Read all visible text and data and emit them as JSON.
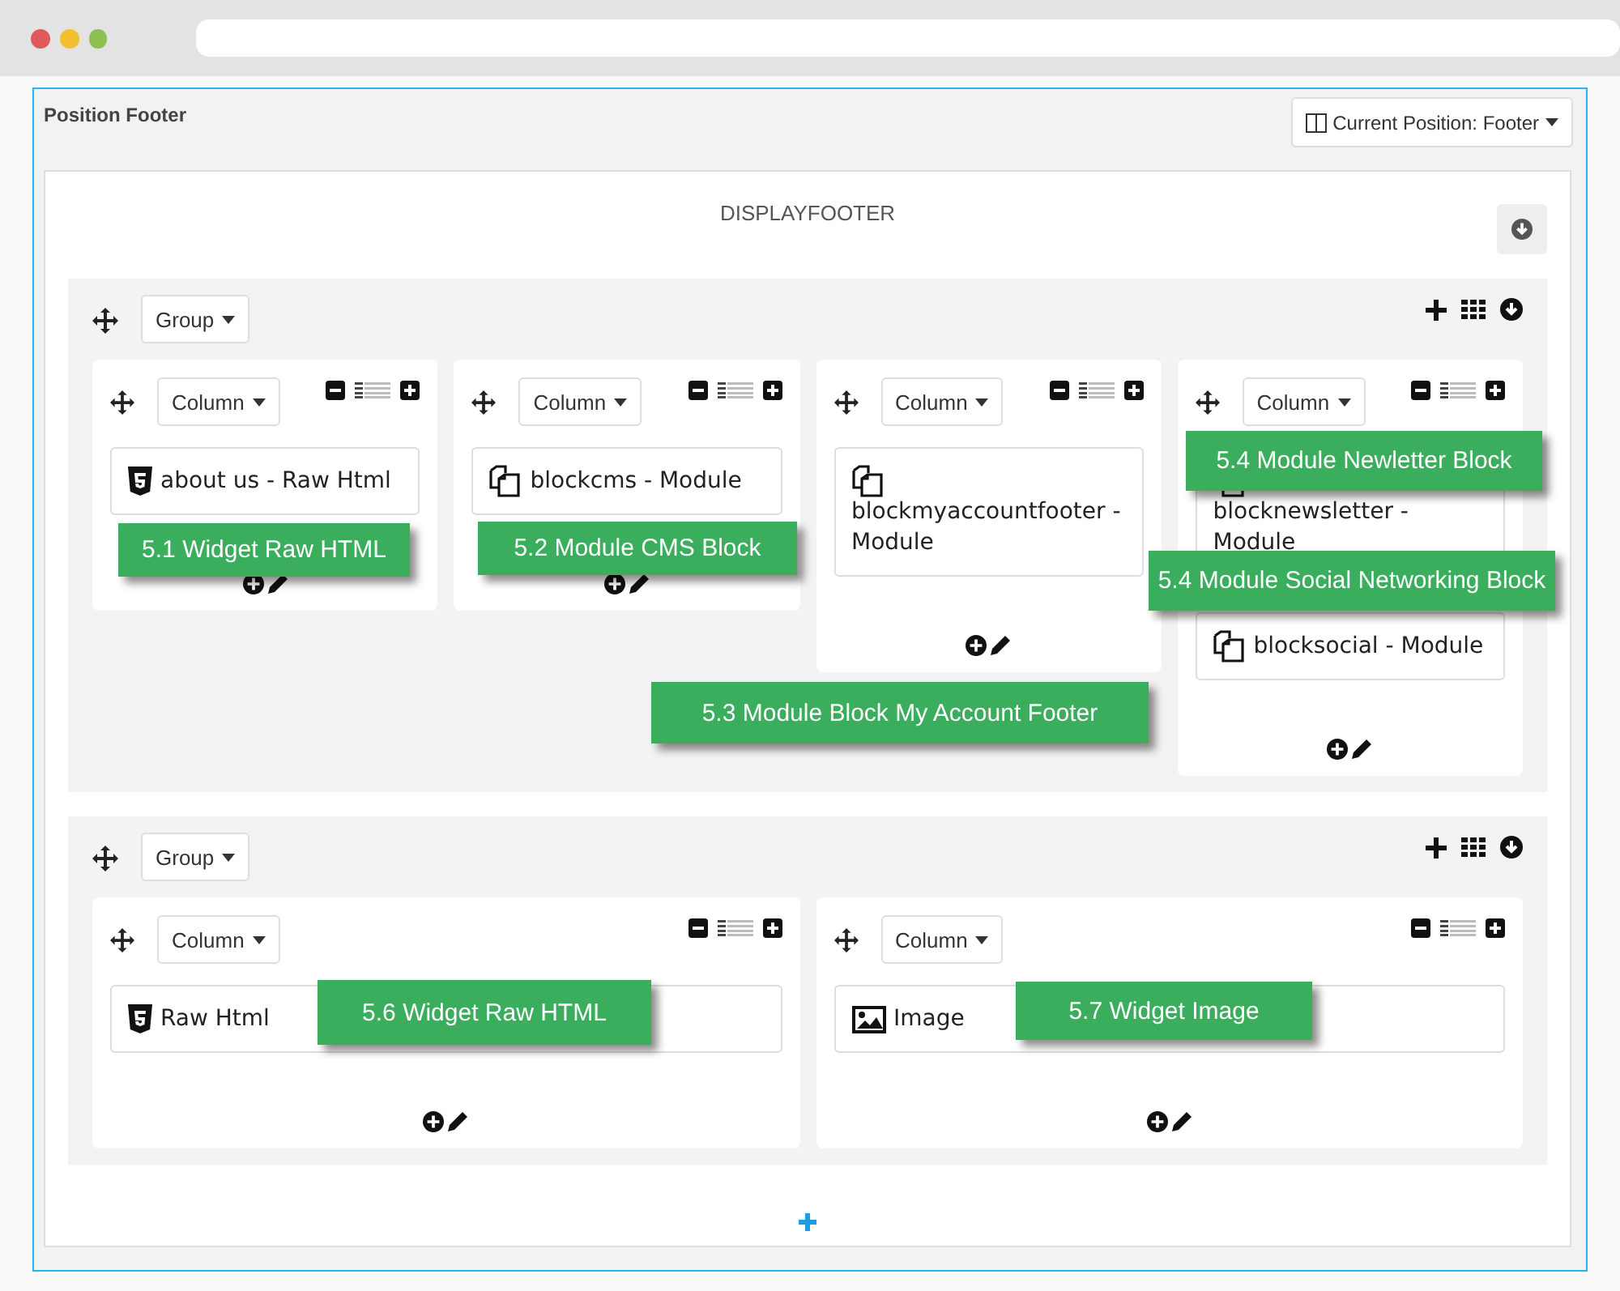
{
  "section_title": "Position Footer",
  "position_button": "Current Position: Footer",
  "hook_title": "DISPLAYFOOTER",
  "groups": [
    {
      "label": "Group",
      "columns": [
        {
          "label": "Column",
          "modules": [
            {
              "kind": "html",
              "text": "about us - Raw Html"
            }
          ]
        },
        {
          "label": "Column",
          "modules": [
            {
              "kind": "module",
              "text": "blockcms - Module"
            }
          ]
        },
        {
          "label": "Column",
          "modules": [
            {
              "kind": "module",
              "text": "blockmyaccountfooter - Module"
            }
          ]
        },
        {
          "label": "Column",
          "modules": [
            {
              "kind": "module",
              "text": "blocknewsletter - Module"
            },
            {
              "kind": "module",
              "text": "blocksocial - Module"
            }
          ]
        }
      ]
    },
    {
      "label": "Group",
      "columns": [
        {
          "label": "Column",
          "modules": [
            {
              "kind": "html",
              "text": "Raw Html"
            }
          ]
        },
        {
          "label": "Column",
          "modules": [
            {
              "kind": "image",
              "text": "Image"
            }
          ]
        }
      ]
    }
  ],
  "callouts": [
    {
      "text": "5.1 Widget Raw HTML"
    },
    {
      "text": "5.2 Module CMS Block"
    },
    {
      "text": "5.3 Module Block My Account Footer"
    },
    {
      "text": "5.4 Module Newletter Block"
    },
    {
      "text": "5.4 Module Social Networking Block"
    },
    {
      "text": "5.6 Widget Raw HTML"
    },
    {
      "text": "5.7 Widget Image"
    }
  ]
}
